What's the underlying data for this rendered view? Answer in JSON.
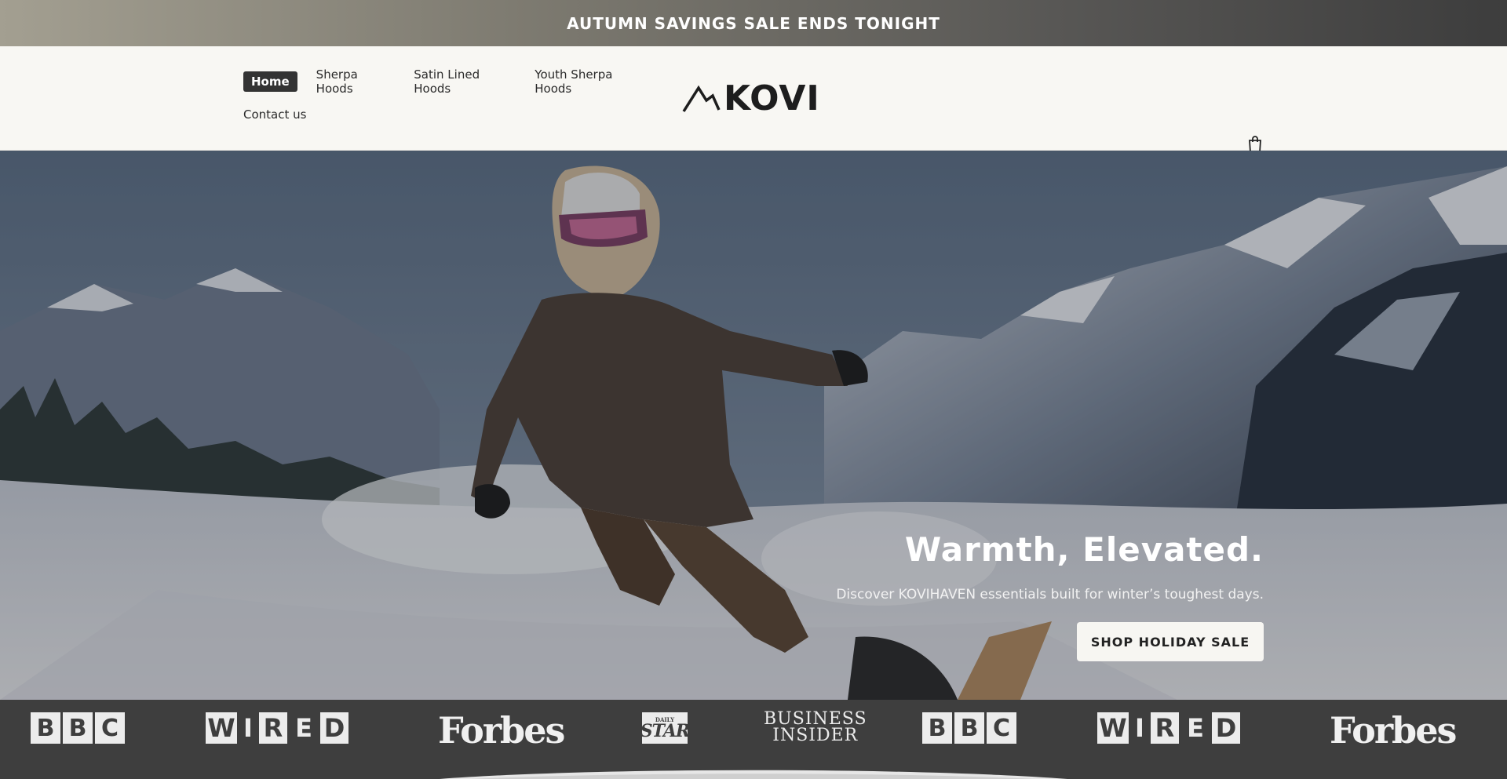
{
  "announcement": "AUTUMN SAVINGS SALE ENDS TONIGHT",
  "nav": {
    "items": [
      {
        "label": "Home",
        "active": true
      },
      {
        "label": "Sherpa Hoods"
      },
      {
        "label": "Satin Lined Hoods"
      },
      {
        "label": "Youth Sherpa Hoods"
      },
      {
        "label": "Contact us"
      }
    ]
  },
  "brand": {
    "name": "KOVI",
    "logo_icon": "mountain-icon"
  },
  "cart": {
    "icon": "shopping-bag-icon"
  },
  "hero": {
    "title": "Warmth, Elevated.",
    "subtitle": "Discover KOVIHAVEN essentials built for winter’s toughest days.",
    "cta": "SHOP HOLIDAY SALE"
  },
  "press": {
    "bbc": [
      "B",
      "B",
      "C"
    ],
    "wired": [
      "W",
      "I",
      "R",
      "E",
      "D"
    ],
    "forbes": "Forbes",
    "daily_star": {
      "top": "DAILY",
      "main": "STAR"
    },
    "business_insider": [
      "BUSINESS",
      "INSIDER"
    ]
  },
  "colors": {
    "accent_dark": "#333333",
    "header_bg": "#f8f7f3",
    "press_bg": "#3e3e3e"
  }
}
